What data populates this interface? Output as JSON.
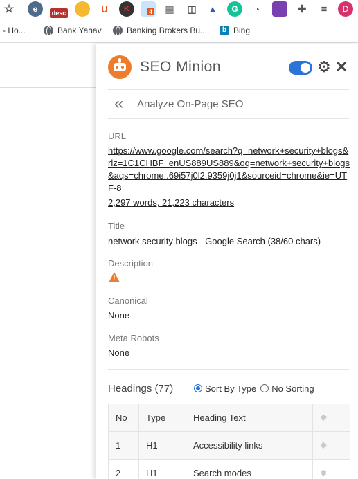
{
  "bookmarks": [
    {
      "label": "- Ho..."
    },
    {
      "label": "Bank Yahav"
    },
    {
      "label": "Banking Brokers Bu..."
    },
    {
      "label": "Bing"
    }
  ],
  "toolbar": {
    "desc_badge": "desc",
    "ext_badge_count": "4",
    "profile_initial": "D"
  },
  "panel": {
    "brand": "SEO Minion",
    "subtitle": "Analyze On-Page SEO",
    "url_label": "URL",
    "url_value": "https://www.google.com/search?q=network+security+blogs&rlz=1C1CHBF_enUS889US889&oq=network+security+blogs&aqs=chrome..69i57j0l2.9359j0j1&sourceid=chrome&ie=UTF-8",
    "counts": "2,297 words, 21,223 characters",
    "title_label": "Title",
    "title_value": "network security blogs - Google Search (38/60 chars)",
    "description_label": "Description",
    "canonical_label": "Canonical",
    "canonical_value": "None",
    "robots_label": "Meta Robots",
    "robots_value": "None",
    "headings_title": "Headings (77)",
    "sort_by_type": "Sort By Type",
    "no_sorting": "No Sorting",
    "table": {
      "headers": [
        "No",
        "Type",
        "Heading Text"
      ],
      "rows": [
        {
          "no": "1",
          "type": "H1",
          "text": "Accessibility links"
        },
        {
          "no": "2",
          "type": "H1",
          "text": "Search modes"
        }
      ]
    }
  },
  "colors": {
    "accent": "#ee7c2d",
    "toggle": "#2c74d8"
  }
}
